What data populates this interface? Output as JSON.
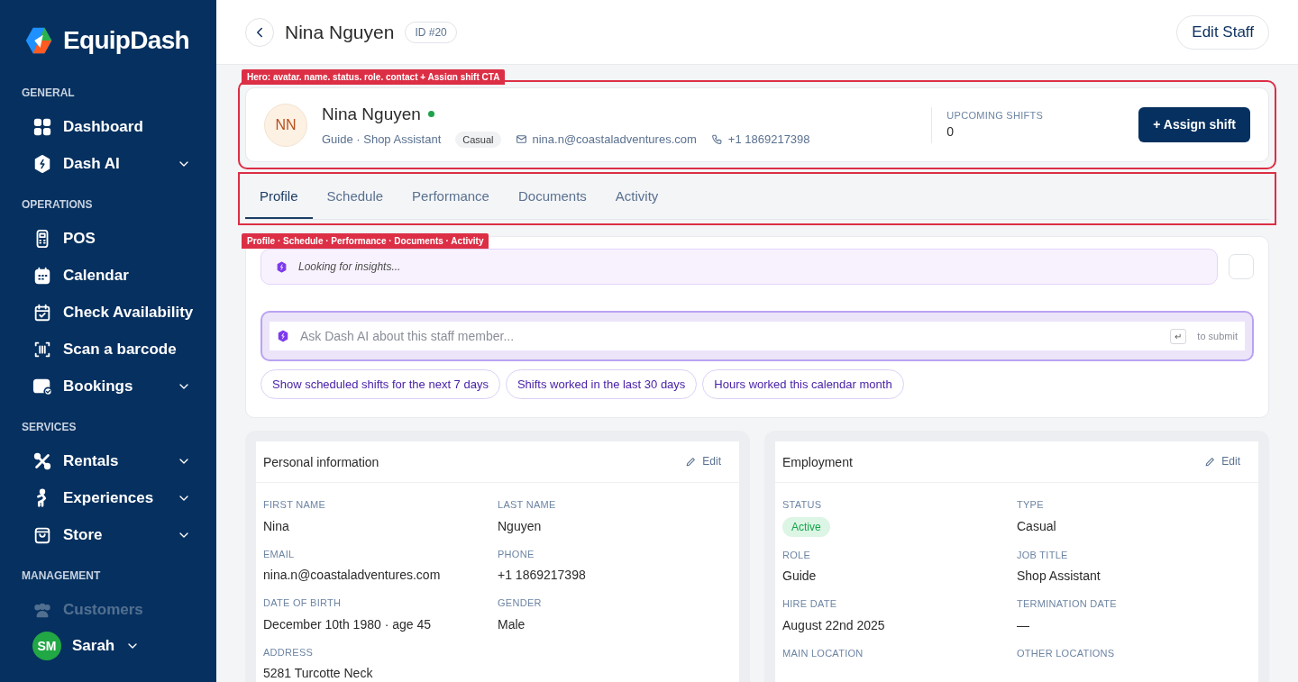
{
  "sidebar": {
    "brand": "EquipDash",
    "sections": [
      {
        "title": "GENERAL",
        "items": [
          {
            "kind": "grid",
            "label": "Dashboard",
            "expandable": false
          },
          {
            "kind": "shield",
            "label": "Dash AI",
            "expandable": true
          }
        ]
      },
      {
        "title": "OPERATIONS",
        "items": [
          {
            "kind": "pos",
            "label": "POS",
            "expandable": false
          },
          {
            "kind": "calendar",
            "label": "Calendar",
            "expandable": false
          },
          {
            "kind": "calcheck",
            "label": "Check Availability",
            "expandable": false
          },
          {
            "kind": "barcode",
            "label": "Scan a barcode",
            "expandable": false
          },
          {
            "kind": "bookings",
            "label": "Bookings",
            "expandable": true
          }
        ]
      },
      {
        "title": "SERVICES",
        "items": [
          {
            "kind": "rentals",
            "label": "Rentals",
            "expandable": true
          },
          {
            "kind": "person",
            "label": "Experiences",
            "expandable": true
          },
          {
            "kind": "bag",
            "label": "Store",
            "expandable": true
          }
        ]
      },
      {
        "title": "MANAGEMENT",
        "items": [
          {
            "kind": "people",
            "label": "Customers",
            "expandable": false
          }
        ]
      }
    ],
    "user": {
      "initials": "SM",
      "name": "Sarah"
    }
  },
  "header": {
    "title": "Nina Nguyen",
    "id_badge": "ID #20",
    "edit_button": "Edit Staff"
  },
  "annotations": [
    "Hero: avatar, name, status, role, contact + Assign shift CTA",
    "Profile · Schedule · Performance · Documents · Activity"
  ],
  "hero": {
    "initials": "NN",
    "name": "Nina Nguyen",
    "online": true,
    "role": "Guide · Shop Assistant",
    "type_badge": "Casual",
    "email": "nina.n@coastaladventures.com",
    "phone": "+1 1869217398",
    "stat_label": "UPCOMING SHIFTS",
    "stat_value": "0",
    "assign_button": "+ Assign shift"
  },
  "tabs": [
    {
      "label": "Profile",
      "selected": true
    },
    {
      "label": "Schedule",
      "selected": false
    },
    {
      "label": "Performance",
      "selected": false
    },
    {
      "label": "Documents",
      "selected": false
    },
    {
      "label": "Activity",
      "selected": false
    }
  ],
  "ai": {
    "insight": "Looking for insights...",
    "placeholder": "Ask Dash AI about this staff member...",
    "submit_key": "↵",
    "submit_hint": "to submit",
    "suggestions": [
      "Show scheduled shifts for the next 7 days",
      "Shifts worked in the last 30 days",
      "Hours worked this calendar month"
    ]
  },
  "cards": [
    {
      "title": "Personal information",
      "edit": "Edit",
      "fields": [
        {
          "label": "FIRST NAME",
          "value": "Nina"
        },
        {
          "label": "LAST NAME",
          "value": "Nguyen"
        },
        {
          "label": "EMAIL",
          "value": "nina.n@coastaladventures.com"
        },
        {
          "label": "PHONE",
          "value": "+1 1869217398"
        },
        {
          "label": "DATE OF BIRTH",
          "value": "December 10th 1980 · age 45"
        },
        {
          "label": "GENDER",
          "value": "Male"
        },
        {
          "label": "ADDRESS",
          "value": "5281 Turcotte Neck"
        }
      ]
    },
    {
      "title": "Employment",
      "edit": "Edit",
      "fields": [
        {
          "label": "STATUS",
          "value": "Active",
          "kind": "badge"
        },
        {
          "label": "TYPE",
          "value": "Casual"
        },
        {
          "label": "ROLE",
          "value": "Guide"
        },
        {
          "label": "JOB TITLE",
          "value": "Shop Assistant"
        },
        {
          "label": "HIRE DATE",
          "value": "August 22nd 2025"
        },
        {
          "label": "TERMINATION DATE",
          "value": "—"
        },
        {
          "label": "MAIN LOCATION"
        },
        {
          "label": "OTHER LOCATIONS"
        }
      ]
    }
  ]
}
